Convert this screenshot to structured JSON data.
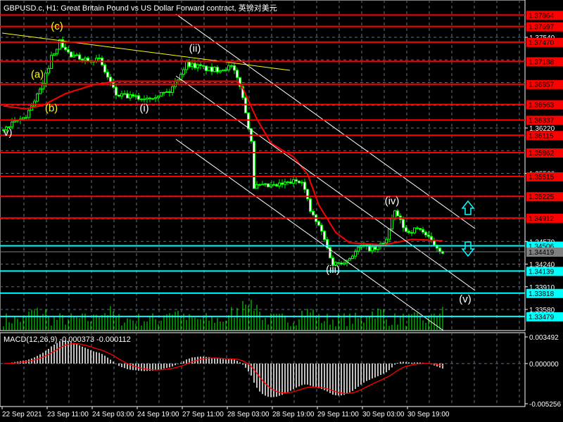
{
  "header": {
    "title": "GBPUSD.c, H1:  Great Britain Pound vs US Dollar Forward contract, 英镑对美元"
  },
  "macd": {
    "title": "MACD(12,26,9) -0.000373 -0.000112",
    "params": [
      12,
      26,
      9
    ],
    "axis_labels": [
      "0.003492",
      "0.000000",
      "-0.005256"
    ],
    "range": [
      -0.005256,
      0.003492
    ]
  },
  "colors": {
    "background": "#000000",
    "bull": "#00ff00",
    "bear": "#ffffff",
    "resistance": "#ff0000",
    "support": "#00ffff",
    "trendline": "#ffff00",
    "channel": "#ffffff",
    "ma": "#ff0000",
    "grid": "#5f6f80"
  },
  "chart_data": {
    "type": "candlestick",
    "symbol": "GBPUSD.c",
    "timeframe": "H1",
    "price_axis": {
      "ticks": [
        "1.37540",
        "1.36220",
        "1.35560",
        "1.34570",
        "1.34240",
        "1.33910",
        "1.33580"
      ],
      "tick_values": [
        1.3754,
        1.3622,
        1.3556,
        1.3457,
        1.3424,
        1.3391,
        1.3358
      ]
    },
    "time_axis": [
      "22 Sep 2021",
      "23 Sep 11:00",
      "24 Sep 03:00",
      "24 Sep 19:00",
      "27 Sep 11:00",
      "28 Sep 03:00",
      "28 Sep 19:00",
      "29 Sep 11:00",
      "30 Sep 03:00",
      "30 Sep 19:00"
    ],
    "bars_per_label": 16,
    "price_path": [
      [
        0,
        1.3619
      ],
      [
        8,
        1.364
      ],
      [
        14,
        1.3685
      ],
      [
        17,
        1.3726
      ],
      [
        20,
        1.3747
      ],
      [
        24,
        1.3726
      ],
      [
        34,
        1.3721
      ],
      [
        40,
        1.367
      ],
      [
        49,
        1.3665
      ],
      [
        59,
        1.3675
      ],
      [
        65,
        1.3716
      ],
      [
        74,
        1.3706
      ],
      [
        81,
        1.3711
      ],
      [
        84,
        1.3685
      ],
      [
        86,
        1.3645
      ],
      [
        88,
        1.3604
      ],
      [
        89,
        1.3537
      ],
      [
        96,
        1.3537
      ],
      [
        106,
        1.3547
      ],
      [
        109,
        1.3501
      ],
      [
        113,
        1.3471
      ],
      [
        117,
        1.3424
      ],
      [
        122,
        1.343
      ],
      [
        127,
        1.345
      ],
      [
        132,
        1.3445
      ],
      [
        136,
        1.346
      ],
      [
        139,
        1.3501
      ],
      [
        143,
        1.3471
      ],
      [
        148,
        1.3476
      ],
      [
        152,
        1.3456
      ],
      [
        156,
        1.34419
      ]
    ],
    "ma_path": [
      [
        0,
        1.3654
      ],
      [
        8,
        1.365
      ],
      [
        14,
        1.3655
      ],
      [
        22,
        1.3672
      ],
      [
        32,
        1.3685
      ],
      [
        40,
        1.369
      ],
      [
        64,
        1.369
      ],
      [
        83,
        1.369
      ],
      [
        85,
        1.368
      ],
      [
        90,
        1.3635
      ],
      [
        95,
        1.36
      ],
      [
        103,
        1.358
      ],
      [
        108,
        1.3555
      ],
      [
        112,
        1.351
      ],
      [
        118,
        1.347
      ],
      [
        123,
        1.3455
      ],
      [
        135,
        1.3452
      ],
      [
        145,
        1.346
      ],
      [
        156,
        1.3458
      ]
    ],
    "current_price": "1.34419",
    "resistance_levels": [
      "1.37864",
      "1.37697",
      "1.37470",
      "1.37188",
      "1.36857",
      "1.36563",
      "1.36337",
      "1.36115",
      "1.35862",
      "1.35515",
      "1.35225",
      "1.34912"
    ],
    "support_levels": [
      "1.34506",
      "1.34139",
      "1.33818",
      "1.33479"
    ],
    "wave_labels": [
      {
        "text": "(a)",
        "bar": 12,
        "price": 1.3695,
        "color": "#ffff00"
      },
      {
        "text": "(b)",
        "bar": 17,
        "price": 1.3646,
        "color": "#ffff00"
      },
      {
        "text": "(c)",
        "bar": 19,
        "price": 1.3765,
        "color": "#ffff00"
      },
      {
        "text": "(i)",
        "bar": 50,
        "price": 1.3646,
        "color": "#ffffff"
      },
      {
        "text": "(ii)",
        "bar": 68,
        "price": 1.3733,
        "color": "#ffffff"
      },
      {
        "text": "(iii)",
        "bar": 117,
        "price": 1.3411,
        "color": "#ffffff"
      },
      {
        "text": "(iv)",
        "bar": 138,
        "price": 1.3511,
        "color": "#ffffff"
      },
      {
        "text": "(v)",
        "bar": 164,
        "price": 1.3368,
        "color": "#ffffff"
      },
      {
        "text": "v)",
        "bar": 0,
        "price": 1.3611,
        "color": "#ffffff"
      }
    ]
  }
}
